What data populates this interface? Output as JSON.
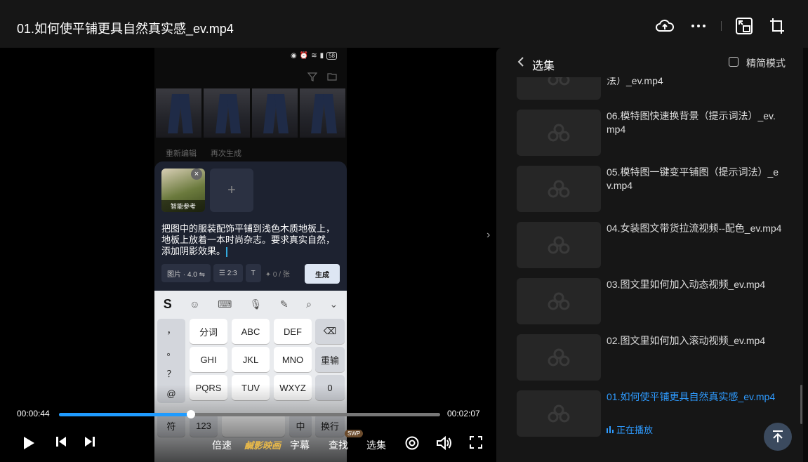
{
  "window": {
    "title": "01.如何使平铺更具自然真实感_ev.mp4"
  },
  "phone": {
    "battery": "58",
    "actions": [
      "重新编辑",
      "再次生成"
    ],
    "ref_card_label": "智能参考",
    "add_symbol": "+",
    "prompt": "把图中的服装配饰平铺到浅色木质地板上，地板上放着一本时尚杂志。要求真实自然，添加阴影效果。",
    "options": [
      "图片 · 4.0 ⇋",
      "☰ 2:3",
      "T"
    ],
    "count": "✦ 0 / 张",
    "generate": "生成",
    "keyboard": {
      "side_keys": [
        "，",
        "。",
        "？",
        "@"
      ],
      "rows": [
        [
          "分词",
          "ABC",
          "DEF"
        ],
        [
          "GHI",
          "JKL",
          "MNO"
        ],
        [
          "PQRS",
          "TUV",
          "WXYZ"
        ]
      ],
      "right_keys": [
        "⌫",
        "重输",
        "0"
      ],
      "bottom": [
        "符",
        "123",
        "中",
        "换行"
      ]
    }
  },
  "player": {
    "current_time": "00:00:44",
    "duration": "00:02:07",
    "progress": 0.346,
    "speed": "倍速",
    "brand": "鹹影映画",
    "subtitle": "字幕",
    "search": "查找",
    "search_badge": "SWP",
    "episodes": "选集"
  },
  "panel": {
    "title": "选集",
    "mode_label": "精简模式",
    "episodes": [
      {
        "title": "法）_ev.mp4",
        "active": false
      },
      {
        "title": "06.模特图快速换背景（提示词法）_ev.mp4",
        "active": false
      },
      {
        "title": "05.模特图一键变平铺图（提示词法）_ev.mp4",
        "active": false
      },
      {
        "title": "04.女装图文带货拉流视频--配色_ev.mp4",
        "active": false
      },
      {
        "title": "03.图文里如何加入动态视频_ev.mp4",
        "active": false
      },
      {
        "title": "02.图文里如何加入滚动视频_ev.mp4",
        "active": false
      },
      {
        "title": "01.如何使平铺更具自然真实感_ev.mp4",
        "active": true
      }
    ],
    "now_playing": "正在播放"
  },
  "colors": {
    "accent": "#2e9bff",
    "panel_bg": "#161616",
    "progress": "#1f9bff"
  },
  "icons": [
    "cloud-upload-icon",
    "more-icon",
    "picture-in-picture-icon",
    "crop-icon",
    "play-icon",
    "prev-icon",
    "next-icon",
    "settings-icon",
    "volume-icon",
    "fullscreen-icon",
    "back-icon",
    "scroll-top-icon"
  ]
}
